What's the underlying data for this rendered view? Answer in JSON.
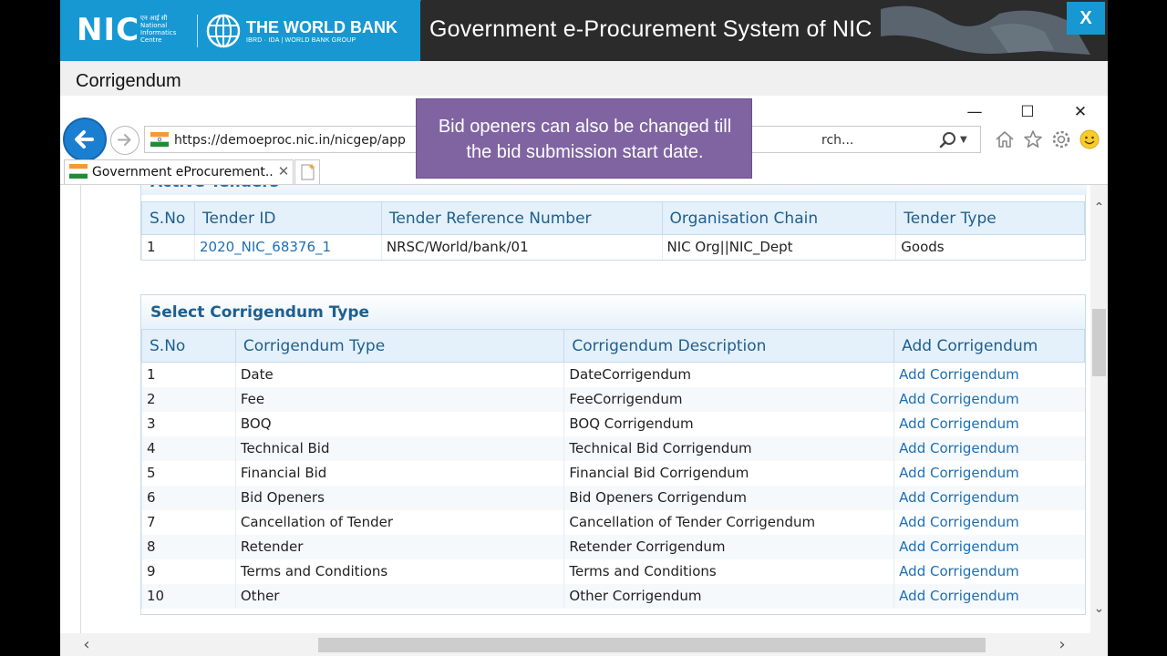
{
  "banner": {
    "nic_logo": "NIC",
    "nic_sub": [
      "एन आई सी",
      "National",
      "Informatics",
      "Centre"
    ],
    "wb_name": "THE WORLD BANK",
    "wb_sub": "IBRD · IDA | WORLD BANK GROUP",
    "title": "Government e-Procurement System of NIC",
    "close_label": "X"
  },
  "window_title": "Corrigendum",
  "browser": {
    "url": "https://demoeproc.nic.in/nicgep/app",
    "search_placeholder": "rch...",
    "tab_title": "Government eProcurement...",
    "tab_close": "✕",
    "window_controls": {
      "minimize": "—",
      "maximize": "☐",
      "close": "✕"
    }
  },
  "callout": "Bid openers can also be changed till the bid submission start date.",
  "active_tenders": {
    "heading": "Active Tenders",
    "columns": [
      "S.No",
      "Tender ID",
      "Tender Reference Number",
      "Organisation Chain",
      "Tender Type"
    ],
    "rows": [
      {
        "sno": "1",
        "tender_id": "2020_NIC_68376_1",
        "ref": "NRSC/World/bank/01",
        "org": "NIC Org||NIC_Dept",
        "type": "Goods"
      }
    ]
  },
  "corrigendum": {
    "heading": "Select Corrigendum Type",
    "columns": [
      "S.No",
      "Corrigendum Type",
      "Corrigendum Description",
      "Add Corrigendum"
    ],
    "rows": [
      {
        "sno": "1",
        "type": "Date",
        "desc": "DateCorrigendum",
        "action": "Add Corrigendum"
      },
      {
        "sno": "2",
        "type": "Fee",
        "desc": "FeeCorrigendum",
        "action": "Add Corrigendum"
      },
      {
        "sno": "3",
        "type": "BOQ",
        "desc": "BOQ Corrigendum",
        "action": "Add Corrigendum"
      },
      {
        "sno": "4",
        "type": "Technical Bid",
        "desc": "Technical Bid Corrigendum",
        "action": "Add Corrigendum"
      },
      {
        "sno": "5",
        "type": "Financial Bid",
        "desc": "Financial Bid Corrigendum",
        "action": "Add Corrigendum"
      },
      {
        "sno": "6",
        "type": "Bid Openers",
        "desc": "Bid Openers Corrigendum",
        "action": "Add Corrigendum"
      },
      {
        "sno": "7",
        "type": "Cancellation of Tender",
        "desc": "Cancellation of Tender Corrigendum",
        "action": "Add Corrigendum"
      },
      {
        "sno": "8",
        "type": "Retender",
        "desc": "Retender Corrigendum",
        "action": "Add Corrigendum"
      },
      {
        "sno": "9",
        "type": "Terms and Conditions",
        "desc": "Terms and Conditions",
        "action": "Add Corrigendum"
      },
      {
        "sno": "10",
        "type": "Other",
        "desc": "Other Corrigendum",
        "action": "Add Corrigendum"
      }
    ]
  },
  "colors": {
    "banner_blue": "#1798d3",
    "callout_purple": "#8064a2",
    "link_blue": "#1d6fb4",
    "header_blue": "#1f5f8f"
  }
}
